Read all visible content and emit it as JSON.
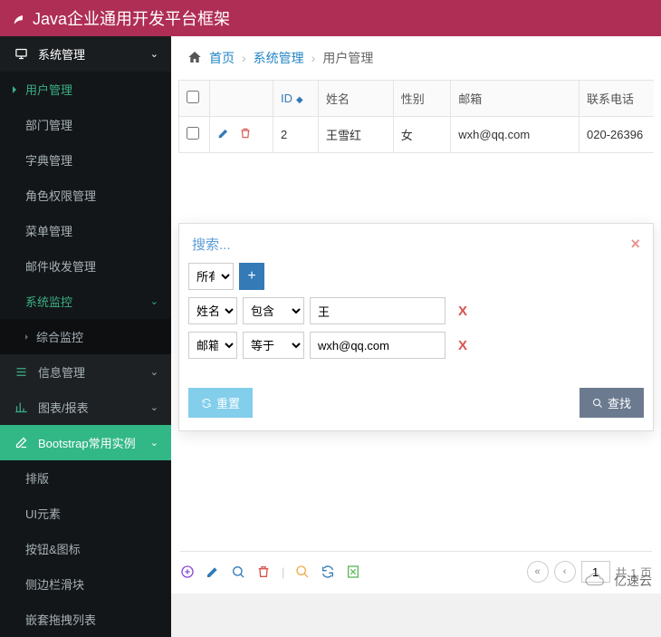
{
  "header": {
    "title": "Java企业通用开发平台框架"
  },
  "sidebar": {
    "groups": [
      {
        "label": "系统管理",
        "icon": "monitor"
      },
      {
        "label": "信息管理",
        "icon": "list"
      },
      {
        "label": "图表/报表",
        "icon": "chart"
      },
      {
        "label": "Bootstrap常用实例",
        "icon": "edit"
      }
    ],
    "system_children": [
      "用户管理",
      "部门管理",
      "字典管理",
      "角色权限管理",
      "菜单管理",
      "邮件收发管理",
      "系统监控"
    ],
    "monitor_children": [
      "综合监控"
    ],
    "bootstrap_children": [
      "排版",
      "UI元素",
      "按钮&图标",
      "侧边栏滑块",
      "嵌套拖拽列表"
    ]
  },
  "breadcrumb": {
    "home": "首页",
    "mid": "系统管理",
    "leaf": "用户管理"
  },
  "table": {
    "headers": {
      "id": "ID",
      "name": "姓名",
      "gender": "性别",
      "email": "邮箱",
      "phone": "联系电话"
    },
    "rows": [
      {
        "id": "2",
        "name": "王雪红",
        "gender": "女",
        "email": "wxh@qq.com",
        "phone": "020-26396"
      }
    ]
  },
  "search": {
    "title": "搜索...",
    "all_option": "所有",
    "rows": [
      {
        "field": "姓名",
        "op": "包含",
        "value": "王"
      },
      {
        "field": "邮箱",
        "op": "等于",
        "value": "wxh@qq.com"
      }
    ],
    "reset_label": "重置",
    "search_label": "查找"
  },
  "pager": {
    "page": "1",
    "total_label": "共 1 页"
  },
  "watermark": "亿速云",
  "colors": {
    "brand": "#af2e56",
    "accent": "#32b787",
    "link": "#2385c4"
  }
}
